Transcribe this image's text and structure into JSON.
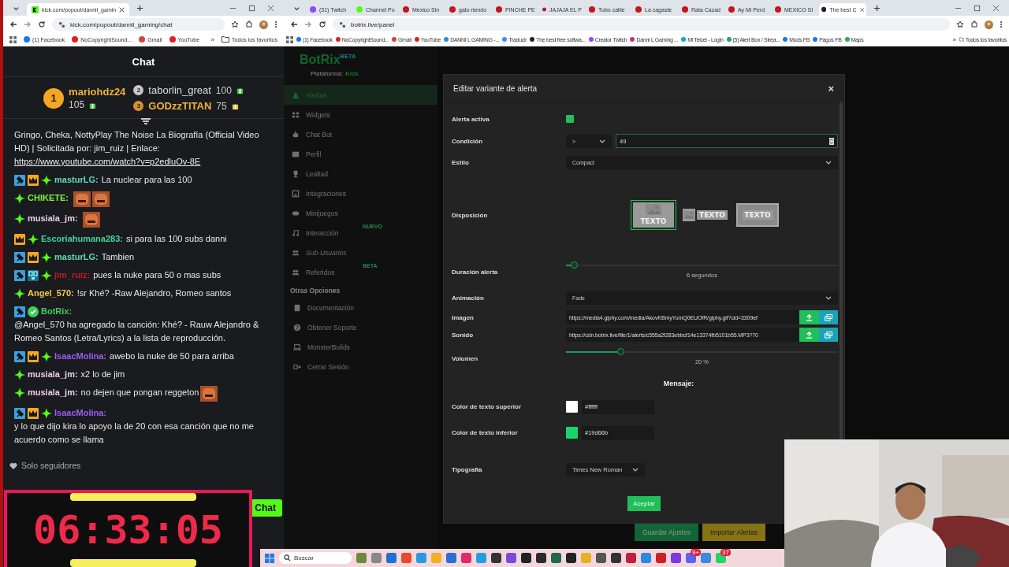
{
  "chat_window": {
    "tab": {
      "title": "kick.com/popout/dannil_gamin"
    },
    "address": "kick.com/popout/dannil_gaming/chat",
    "bookmarks": [
      "(1) Facebook",
      "NoCopyrightSound...",
      "Gmail",
      "YouTube"
    ],
    "more": "»",
    "all_bookmarks": "Todos los favoritos",
    "chat": {
      "title": "Chat",
      "leaderboard": [
        {
          "rank": "1",
          "user": "mariohdz24",
          "count": "105"
        },
        {
          "rank": "2",
          "user": "taborlin_great",
          "count": "100"
        },
        {
          "rank": "3",
          "user": "GODzzTITAN",
          "count": "75"
        }
      ],
      "messages": [
        {
          "text": "Gringo, Cheka, NottyPlay The Noise La Biografía (Official Video HD) | Solicitada por: jim_ruiz | Enlace:",
          "link": "https://www.youtube.com/watch?v=p2edluOv-8E"
        },
        {
          "badges": [
            {
              "kind": "mod"
            },
            {
              "kind": "sub"
            },
            {
              "kind": "star"
            }
          ],
          "user": "masturLG:",
          "color": "#5fdcb4",
          "text": "La nuclear para las 100"
        },
        {
          "badges": [
            {
              "kind": "star"
            }
          ],
          "user": "CHIKETE:",
          "color": "#7df03c",
          "emotes": [
            {
              "kind": "emote"
            },
            {
              "kind": "emote"
            }
          ]
        },
        {
          "badges": [
            {
              "kind": "star"
            }
          ],
          "user": "musiala_jm:",
          "color": "#e8cfe6",
          "emotes": [
            {
              "kind": "emote"
            }
          ]
        },
        {
          "badges": [
            {
              "kind": "sub"
            },
            {
              "kind": "star"
            }
          ],
          "user": "Escoriahumana283:",
          "color": "#3fd49c",
          "text": "si para las 100 subs danni"
        },
        {
          "badges": [
            {
              "kind": "mod"
            },
            {
              "kind": "sub"
            },
            {
              "kind": "star"
            }
          ],
          "user": "masturLG:",
          "color": "#5fdcb4",
          "text": "Tambien"
        },
        {
          "badges": [
            {
              "kind": "mod"
            },
            {
              "kind": "og"
            },
            {
              "kind": "star"
            }
          ],
          "user": "jim_ruiz:",
          "color": "#c4182a",
          "text": "pues la nuke para 50 o mas subs"
        },
        {
          "badges": [
            {
              "kind": "star"
            }
          ],
          "user": "Angel_570:",
          "color": "#f2c94c",
          "text": "!sr Khé? -Raw Alejandro, Romeo santos"
        },
        {
          "badges": [
            {
              "kind": "mod"
            },
            {
              "kind": "verified"
            }
          ],
          "user": "BotRix:",
          "color": "#3ccf5c",
          "text": "@Angel_570 ha agregado la canción: Khé? - Rauw Alejandro & Romeo Santos (Letra/Lyrics) a la lista de reproducción."
        },
        {
          "badges": [
            {
              "kind": "mod"
            },
            {
              "kind": "sub"
            },
            {
              "kind": "star"
            }
          ],
          "user": "IsaacMolina:",
          "color": "#9d5cf2",
          "text": "awebo la nuke de 50 para arriba"
        },
        {
          "badges": [
            {
              "kind": "star"
            }
          ],
          "user": "musiala_jm:",
          "color": "#e8cfe6",
          "text": "x2 lo de jim"
        },
        {
          "badges": [
            {
              "kind": "star"
            }
          ],
          "user": "musiala_jm:",
          "color": "#e8cfe6",
          "text": "no dejen que pongan reggeton",
          "emotes": [
            {
              "kind": "emote"
            }
          ]
        },
        {
          "badges": [
            {
              "kind": "mod"
            },
            {
              "kind": "sub"
            },
            {
              "kind": "star"
            }
          ],
          "user": "IsaacMolina:",
          "color": "#9d5cf2",
          "text": "y lo que dijo kira lo apoyo la de 20 con esa canción que no me acuerdo como se llama"
        }
      ],
      "follower_mode": "Solo seguidores",
      "send_button": "Chat"
    },
    "timer": "06:33:05"
  },
  "panel_window": {
    "tabs": [
      {
        "title": "(31) Twitch",
        "selected": false
      },
      {
        "title": "Channel Po",
        "selected": false
      },
      {
        "title": "Mexico Sin",
        "selected": false
      },
      {
        "title": "gato riendo",
        "selected": false
      },
      {
        "title": "PINCHE PE",
        "selected": false
      },
      {
        "title": "JAJAJA EL P",
        "selected": false
      },
      {
        "title": "Tubo callie",
        "selected": false
      },
      {
        "title": "La cagaste",
        "selected": false
      },
      {
        "title": "Rata Cazad",
        "selected": false
      },
      {
        "title": "Ay Mi Perd",
        "selected": false
      },
      {
        "title": "MEXICO SI",
        "selected": false
      },
      {
        "title": "The best C",
        "selected": true
      }
    ],
    "address": "botrix.live/panel",
    "bookmarks": [
      "(1) Facebook",
      "NoCopyrightSound...",
      "Gmail",
      "YouTube",
      "DANNI L GAMING -...",
      "Traducir",
      "The best free softwa...",
      "Creator Twitch",
      "Danni L Gaming ...",
      "Mi Telcel - Login",
      "(5) Alert Box / Strea...",
      "Mods FB",
      "Pagos FB",
      "Maps"
    ],
    "more": "»",
    "all_bookmarks": "Todos los favoritos",
    "app": {
      "logo": "BotRix",
      "logo_badge": "BETA",
      "platform_label": "Plataforma:",
      "platform": "Kick",
      "nav": [
        {
          "label": "Alertas",
          "selected": true,
          "disabled": false
        },
        {
          "label": "Widgets",
          "selected": false,
          "disabled": false
        },
        {
          "label": "Chat Bot",
          "selected": false,
          "disabled": false
        },
        {
          "label": "Perfil",
          "selected": false,
          "disabled": false
        },
        {
          "label": "Lealtad",
          "selected": false,
          "disabled": false
        },
        {
          "label": "Integraciones",
          "selected": false,
          "disabled": false
        },
        {
          "label": "Minijuegos",
          "selected": false,
          "disabled": false
        },
        {
          "label": "Interacción",
          "selected": false,
          "disabled": false,
          "tag": "NUEVO"
        },
        {
          "label": "Sub-Usuarios",
          "selected": false,
          "disabled": true
        },
        {
          "label": "Referidos",
          "selected": false,
          "disabled": false,
          "tag": "BETA"
        }
      ],
      "section_title": "Otras Opciones",
      "other": [
        "Documentación",
        "Obtener Soporte",
        "MonsterBuilds",
        "Cerrar Sesión"
      ],
      "buttons": [
        {
          "kind": "save",
          "label": "Guardar Ajustes"
        },
        {
          "kind": "import",
          "label": "Importar Alertas"
        }
      ]
    },
    "modal": {
      "title": "Editar variante de alerta",
      "close": "×",
      "fields": [
        {
          "kind": "checkbox",
          "label": "Alerta activa",
          "checked": true
        },
        {
          "kind": "condition",
          "label": "Condición",
          "operator": ">",
          "value": "49"
        },
        {
          "kind": "select",
          "label": "Estilo",
          "value": "Compact"
        },
        {
          "kind": "layout",
          "label": "Disposición",
          "options": [
            {
              "kind": "stacked",
              "text": "TEXTO",
              "selected": true
            },
            {
              "kind": "side",
              "text": "TEXTO",
              "selected": false
            },
            {
              "kind": "overlay",
              "text": "TEXTO",
              "selected": false
            }
          ]
        },
        {
          "kind": "slider",
          "label": "Duración alerta",
          "level": 0.03,
          "reading": "6 segundos"
        },
        {
          "kind": "select",
          "label": "Animación",
          "value": "Fade"
        },
        {
          "kind": "file",
          "label": "Imagen",
          "value": "https://media4.giphy.com/media/AkovKBmyYumQ0EUOfR/giphy.gif?cid=3309ef"
        },
        {
          "kind": "file",
          "label": "Sonido",
          "value": "https://cdn.botrix.live/file/1/alerts/c555a2f283ebbcf14e13374fb5101b55.MP3?70"
        },
        {
          "kind": "slider",
          "label": "Volumen",
          "level": 0.2,
          "reading": "20 %"
        },
        {
          "kind": "heading",
          "text": "Mensaje:"
        },
        {
          "kind": "color",
          "label": "Color de texto superior",
          "color": "#ffffff",
          "value": "#ffffff"
        },
        {
          "kind": "color",
          "label": "Color de texto inferior",
          "color": "#19d66b",
          "value": "#19d66b"
        },
        {
          "kind": "font",
          "label": "Tipografia",
          "value": "Times New Roman"
        }
      ],
      "accept": "Aceptar"
    }
  },
  "taskbar": {
    "search": "Buscar",
    "apps": [
      {
        "kind": "app"
      },
      {
        "kind": "app"
      },
      {
        "kind": "app"
      },
      {
        "kind": "app"
      },
      {
        "kind": "app"
      },
      {
        "kind": "app"
      },
      {
        "kind": "app"
      },
      {
        "kind": "app"
      },
      {
        "kind": "app"
      },
      {
        "kind": "app"
      },
      {
        "kind": "app"
      },
      {
        "kind": "app"
      },
      {
        "kind": "app"
      },
      {
        "kind": "app"
      },
      {
        "kind": "app"
      },
      {
        "kind": "app"
      },
      {
        "kind": "app"
      },
      {
        "kind": "app"
      },
      {
        "kind": "app"
      },
      {
        "kind": "app"
      },
      {
        "kind": "app"
      },
      {
        "kind": "app"
      },
      {
        "kind": "app",
        "badge": "9+"
      },
      {
        "kind": "app"
      },
      {
        "kind": "app",
        "badge": "37"
      }
    ]
  }
}
